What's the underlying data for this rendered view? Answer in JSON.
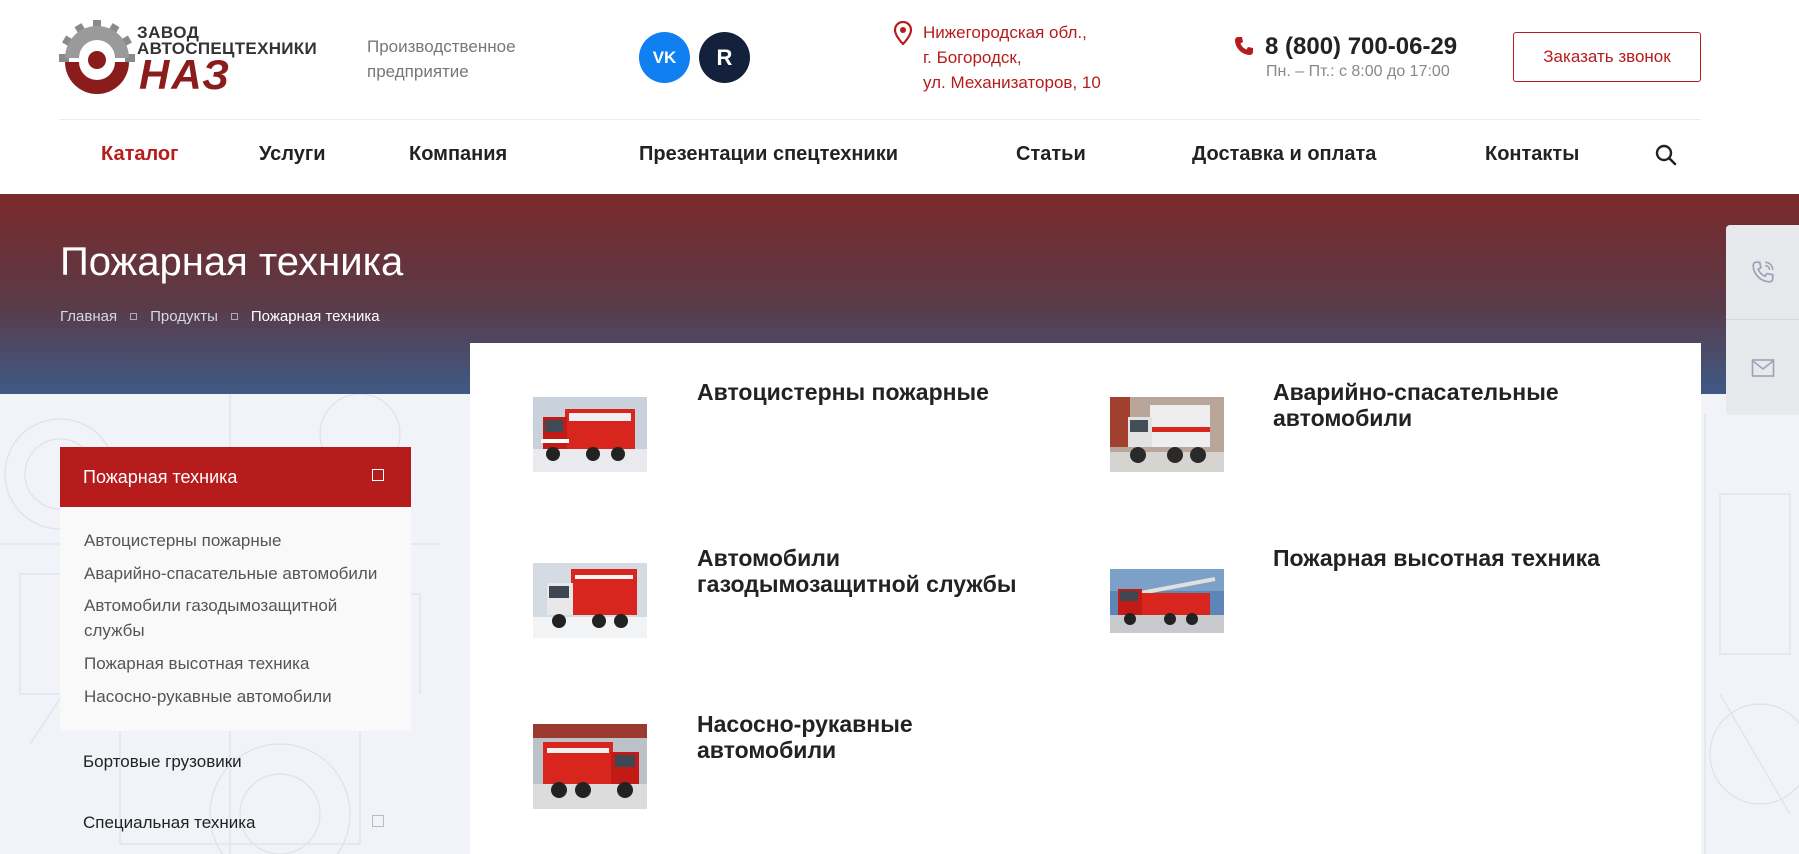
{
  "header": {
    "logo": {
      "line1": "ЗАВОД",
      "line2": "АВТОСПЕЦТЕХНИКИ",
      "naz": "НАЗ"
    },
    "tagline": "Производственное предприятие",
    "social": [
      {
        "label": "VK",
        "icon": "vk-icon",
        "color": "#0f7ff2"
      },
      {
        "label": "R",
        "icon": "rutube-icon",
        "color": "#14213d"
      }
    ],
    "address": {
      "line1": "Нижегородская обл.,",
      "line2": "г. Богородск,",
      "line3": "ул. Механизаторов, 10"
    },
    "phone": "8 (800) 700-06-29",
    "hours": "Пн. – Пт.: с 8:00 до 17:00",
    "callback_label": "Заказать звонок"
  },
  "nav": {
    "items": [
      {
        "label": "Каталог",
        "active": true
      },
      {
        "label": "Услуги"
      },
      {
        "label": "Компания"
      },
      {
        "label": "Презентации спецтехники"
      },
      {
        "label": "Статьи"
      },
      {
        "label": "Доставка и оплата"
      },
      {
        "label": "Контакты"
      }
    ]
  },
  "banner": {
    "title": "Пожарная техника",
    "breadcrumb": [
      "Главная",
      "Продукты",
      "Пожарная техника"
    ]
  },
  "sidebar": {
    "active": "Пожарная техника",
    "sub_items": [
      "Автоцистерны пожарные",
      "Аварийно-спасательные автомобили",
      "Автомобили газодымозащитной службы",
      "Пожарная высотная техника",
      "Насосно-рукавные автомобили"
    ],
    "items": [
      "Бортовые грузовики",
      "Специальная техника"
    ]
  },
  "products": [
    {
      "title": "Автоцистерны пожарные",
      "image": "fire-tanker-truck-photo"
    },
    {
      "title": "Аварийно-спасательные автомобили",
      "image": "rescue-truck-photo"
    },
    {
      "title": "Автомобили газодымозащитной службы",
      "image": "gas-smoke-protection-truck-photo"
    },
    {
      "title": "Пожарная высотная техника",
      "image": "aerial-ladder-truck-photo"
    },
    {
      "title": "Насосно-рукавные автомобили",
      "image": "pump-hose-truck-photo"
    }
  ],
  "colors": {
    "accent": "#b71c1c",
    "dark_text": "#222222",
    "muted": "#777777",
    "vk": "#0f7ff2",
    "rutube": "#14213d"
  }
}
